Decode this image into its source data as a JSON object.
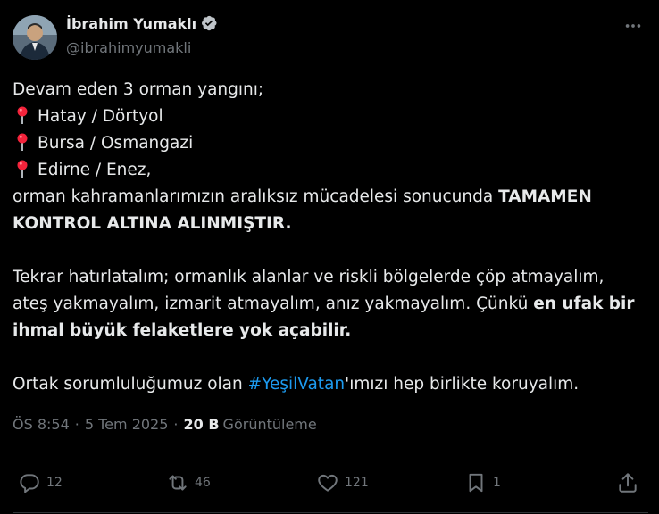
{
  "author": {
    "name": "İbrahim Yumaklı",
    "handle": "@ibrahimyumakli"
  },
  "tweet": {
    "line1": "Devam eden 3 orman yangını;",
    "locations": [
      "Hatay / Dörtyol",
      "Bursa / Osmangazi",
      "Edirne / Enez,"
    ],
    "line5_normal": "orman kahramanlarımızın aralıksız mücadelesi sonucunda ",
    "line5_bold": "TAMAMEN",
    "line6_bold": "KONTROL ALTINA ALINMIŞTIR.",
    "para2_line1": "Tekrar hatırlatalım; ormanlık alanlar ve riskli bölgelerde çöp atmayalım,",
    "para2_line2_normal": "ateş yakmayalım, izmarit atmayalım, anız yakmayalım. Çünkü ",
    "para2_line2_bold": "en ufak bir",
    "para2_line3_bold": "ihmal büyük felaketlere yok açabilir.",
    "para3_before": "Ortak sorumluluğumuz olan ",
    "hashtag": "#YeşilVatan",
    "para3_after": "'ımızı hep birlikte koruyalım."
  },
  "meta": {
    "time": "ÖS 8:54",
    "date": "5 Tem 2025",
    "views_count": "20 B",
    "views_label": "Görüntüleme",
    "separator": "·"
  },
  "actions": {
    "replies": "12",
    "retweets": "46",
    "likes": "121",
    "bookmarks": "1"
  },
  "colors": {
    "background": "#000000",
    "text": "#e7e9ea",
    "secondary": "#71767b",
    "accent": "#1d9bf0",
    "divider": "#2f3336",
    "pin": "#f4233b"
  },
  "icons": {
    "verified": "verified-badge-icon",
    "more": "more-horizontal-icon",
    "pin": "round-pushpin-emoji",
    "reply": "reply-icon",
    "retweet": "retweet-icon",
    "like": "heart-icon",
    "bookmark": "bookmark-icon",
    "share": "share-icon"
  }
}
